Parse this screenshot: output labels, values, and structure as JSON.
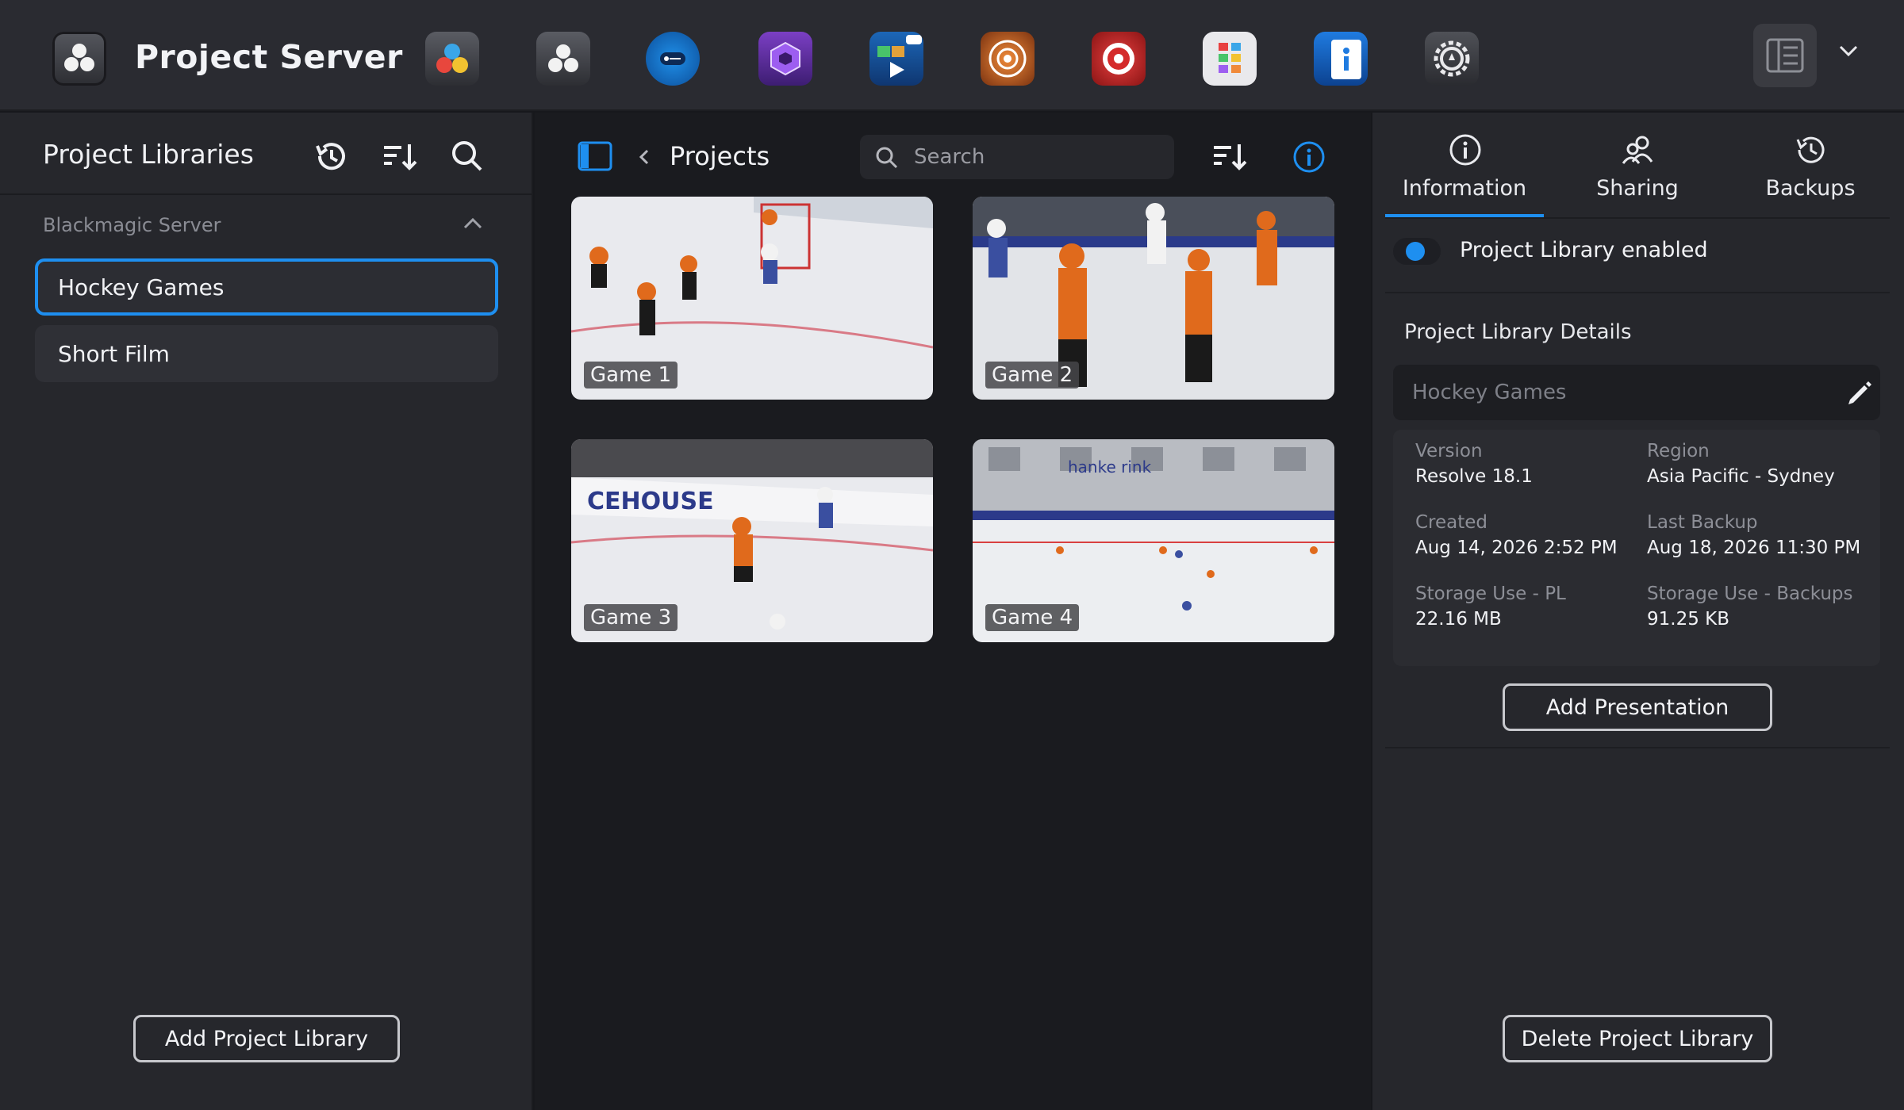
{
  "topbar": {
    "app_title": "Project Server",
    "app_icon": "davinci-resolve-project-server-icon",
    "dock_icons": [
      {
        "name": "davinci-resolve-icon"
      },
      {
        "name": "project-server-icon"
      },
      {
        "name": "license-key-icon"
      },
      {
        "name": "hexagon-app-icon"
      },
      {
        "name": "presentation-chat-icon"
      },
      {
        "name": "network-target-icon"
      },
      {
        "name": "broadcast-icon"
      },
      {
        "name": "color-grid-icon"
      },
      {
        "name": "info-cards-icon"
      },
      {
        "name": "settings-icon"
      }
    ],
    "layout_icon": "panel-layout-icon",
    "menu_icon": "chevron-down-icon"
  },
  "left_panel": {
    "title": "Project Libraries",
    "section": "Blackmagic Server",
    "libraries": [
      {
        "label": "Hockey Games",
        "selected": true
      },
      {
        "label": "Short Film",
        "selected": false
      }
    ],
    "add_button": "Add Project Library"
  },
  "middle_panel": {
    "breadcrumb": "Projects",
    "search_placeholder": "Search",
    "projects": [
      {
        "label": "Game 1"
      },
      {
        "label": "Game 2"
      },
      {
        "label": "Game 3"
      },
      {
        "label": "Game 4"
      }
    ]
  },
  "right_panel": {
    "tabs": [
      {
        "label": "Information",
        "active": true
      },
      {
        "label": "Sharing",
        "active": false
      },
      {
        "label": "Backups",
        "active": false
      }
    ],
    "toggle_label": "Project Library enabled",
    "toggle_on": true,
    "details_title": "Project Library Details",
    "library_name_placeholder": "Hockey Games",
    "meta": [
      {
        "label": "Version",
        "value": "Resolve 18.1"
      },
      {
        "label": "Region",
        "value": "Asia Pacific - Sydney"
      },
      {
        "label": "Created",
        "value": "Aug 14, 2026 2:52 PM"
      },
      {
        "label": "Last Backup",
        "value": "Aug 18, 2026 11:30 PM"
      },
      {
        "label": "Storage Use - PL",
        "value": "22.16 MB"
      },
      {
        "label": "Storage Use - Backups",
        "value": "91.25 KB"
      }
    ],
    "add_presentation_button": "Add Presentation",
    "delete_button": "Delete Project Library"
  },
  "colors": {
    "accent": "#1e8ff0",
    "panel": "#26272c",
    "background": "#1a1b1f"
  }
}
